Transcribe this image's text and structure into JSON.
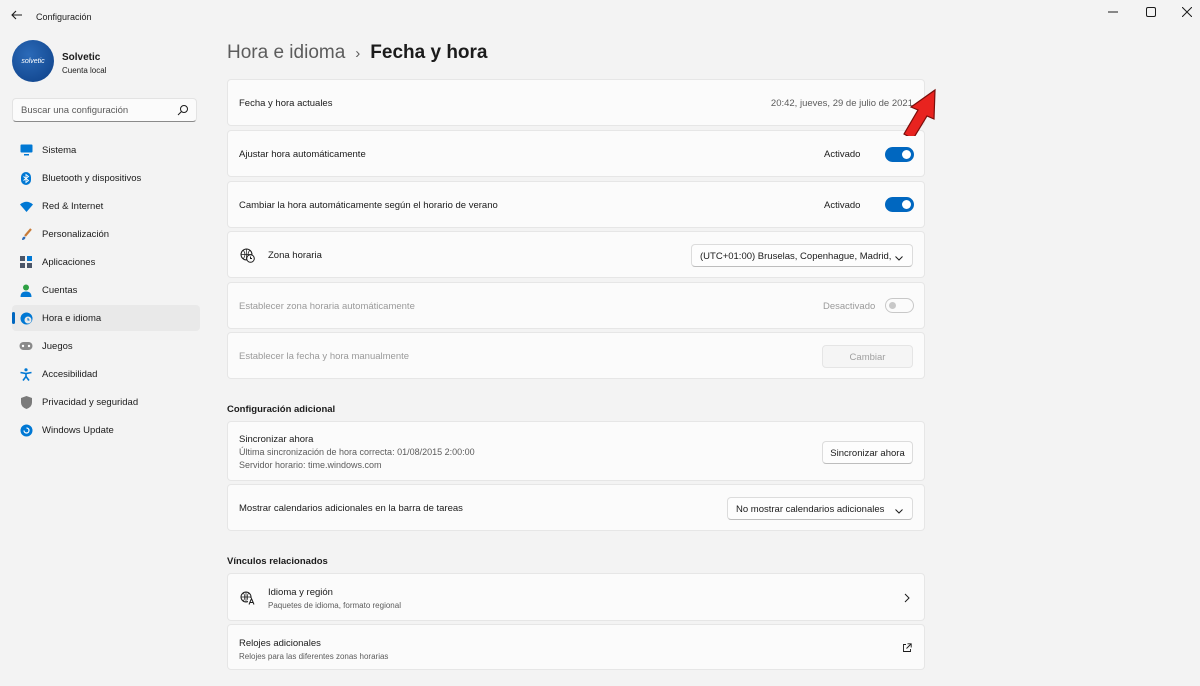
{
  "window": {
    "title": "Configuración"
  },
  "profile": {
    "name": "Solvetic",
    "account_type": "Cuenta local",
    "avatar_text": "solvetic"
  },
  "search": {
    "placeholder": "Buscar una configuración"
  },
  "sidebar": {
    "items": [
      {
        "label": "Sistema",
        "icon": "monitor-icon",
        "color": "#0078d4"
      },
      {
        "label": "Bluetooth y dispositivos",
        "icon": "bluetooth-icon",
        "color": "#0078d4"
      },
      {
        "label": "Red & Internet",
        "icon": "wifi-icon",
        "color": "#0078d4"
      },
      {
        "label": "Personalización",
        "icon": "brush-icon",
        "color": "#c87b38"
      },
      {
        "label": "Aplicaciones",
        "icon": "apps-icon",
        "color": "#4a5568"
      },
      {
        "label": "Cuentas",
        "icon": "person-icon",
        "color": "#2ea043"
      },
      {
        "label": "Hora e idioma",
        "icon": "globe-clock-icon",
        "color": "#0078d4",
        "active": true
      },
      {
        "label": "Juegos",
        "icon": "gamepad-icon",
        "color": "#6b6b6b"
      },
      {
        "label": "Accesibilidad",
        "icon": "accessibility-icon",
        "color": "#0078d4"
      },
      {
        "label": "Privacidad y seguridad",
        "icon": "shield-icon",
        "color": "#6b6b6b"
      },
      {
        "label": "Windows Update",
        "icon": "update-icon",
        "color": "#0078d4"
      }
    ]
  },
  "breadcrumb": {
    "parent": "Hora e idioma",
    "separator": "›",
    "current": "Fecha y hora"
  },
  "settings": {
    "current_datetime": {
      "label": "Fecha y hora actuales",
      "value": "20:42, jueves, 29 de julio de 2021"
    },
    "auto_time": {
      "label": "Ajustar hora automáticamente",
      "state": "Activado",
      "on": true
    },
    "dst": {
      "label": "Cambiar la hora automáticamente según el horario de verano",
      "state": "Activado",
      "on": true
    },
    "timezone": {
      "label": "Zona horaria",
      "value": "(UTC+01:00) Bruselas, Copenhague, Madrid,"
    },
    "auto_timezone": {
      "label": "Establecer zona horaria automáticamente",
      "state": "Desactivado",
      "on": false
    },
    "manual": {
      "label": "Establecer la fecha y hora manualmente",
      "button": "Cambiar"
    }
  },
  "additional": {
    "title": "Configuración adicional",
    "sync": {
      "label": "Sincronizar ahora",
      "last_sync": "Última sincronización de hora correcta: 01/08/2015 2:00:00",
      "server": "Servidor horario: time.windows.com",
      "button": "Sincronizar ahora"
    },
    "calendars": {
      "label": "Mostrar calendarios adicionales en la barra de tareas",
      "value": "No mostrar calendarios adicionales"
    }
  },
  "related": {
    "title": "Vínculos relacionados",
    "language": {
      "label": "Idioma y región",
      "sub": "Paquetes de idioma, formato regional"
    },
    "clocks": {
      "label": "Relojes adicionales",
      "sub": "Relojes para las diferentes zonas horarias"
    }
  },
  "colors": {
    "accent": "#0067c0",
    "annotation_arrow": "#e8231f"
  }
}
